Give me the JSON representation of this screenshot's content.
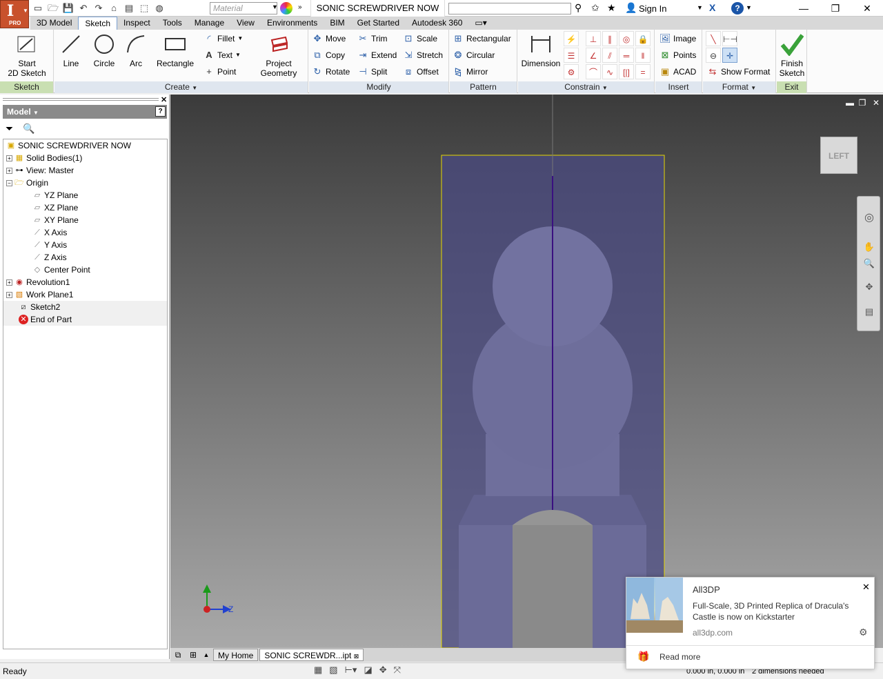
{
  "app": {
    "letter": "I",
    "edition": "PRO"
  },
  "qat": {
    "material_placeholder": "Material"
  },
  "title": "SONIC SCREWDRIVER NOW",
  "account": {
    "sign_in": "Sign In"
  },
  "menu_tabs": [
    "3D Model",
    "Sketch",
    "Inspect",
    "Tools",
    "Manage",
    "View",
    "Environments",
    "BIM",
    "Get Started",
    "Autodesk 360"
  ],
  "ribbon": {
    "sketch": {
      "title": "Sketch",
      "start_l1": "Start",
      "start_l2": "2D Sketch"
    },
    "create": {
      "title": "Create",
      "line": "Line",
      "circle": "Circle",
      "arc": "Arc",
      "rectangle": "Rectangle",
      "fillet": "Fillet",
      "text": "Text",
      "point": "Point",
      "project_l1": "Project",
      "project_l2": "Geometry"
    },
    "modify": {
      "title": "Modify",
      "move": "Move",
      "trim": "Trim",
      "scale": "Scale",
      "copy": "Copy",
      "extend": "Extend",
      "stretch": "Stretch",
      "rotate": "Rotate",
      "split": "Split",
      "offset": "Offset"
    },
    "pattern": {
      "title": "Pattern",
      "rectangular": "Rectangular",
      "circular": "Circular",
      "mirror": "Mirror"
    },
    "constrain": {
      "title": "Constrain",
      "dimension": "Dimension"
    },
    "insert": {
      "title": "Insert",
      "image": "Image",
      "points": "Points",
      "acad": "ACAD"
    },
    "format": {
      "title": "Format",
      "show_format": "Show Format"
    },
    "exit": {
      "title": "Exit",
      "finish_l1": "Finish",
      "finish_l2": "Sketch"
    }
  },
  "browser": {
    "header": "Model",
    "tree": [
      {
        "label": "SONIC SCREWDRIVER NOW"
      },
      {
        "label": "Solid Bodies(1)"
      },
      {
        "label": "View: Master"
      },
      {
        "label": "Origin"
      },
      {
        "label": "YZ Plane"
      },
      {
        "label": "XZ Plane"
      },
      {
        "label": "XY Plane"
      },
      {
        "label": "X Axis"
      },
      {
        "label": "Y Axis"
      },
      {
        "label": "Z Axis"
      },
      {
        "label": "Center Point"
      },
      {
        "label": "Revolution1"
      },
      {
        "label": "Work Plane1"
      },
      {
        "label": "Sketch2"
      },
      {
        "label": "End of Part"
      }
    ]
  },
  "viewport": {
    "viewcube_label": "LEFT",
    "axis_label": "Z"
  },
  "doc_tabs": {
    "home": "My Home",
    "active": "SONIC SCREWDR...ipt"
  },
  "status": {
    "left": "Ready",
    "coords": "0.000 in, 0.000 in",
    "dims": "2 dimensions needed"
  },
  "notification": {
    "source": "All3DP",
    "message": "Full-Scale, 3D Printed Replica of Dracula's Castle is now on Kickstarter",
    "domain": "all3dp.com",
    "action": "Read more"
  },
  "colors": {
    "accent": "#c8512c",
    "sketch_plane": "#4a4a80",
    "part": "#6d6d9a",
    "selection": "#e6d800"
  }
}
